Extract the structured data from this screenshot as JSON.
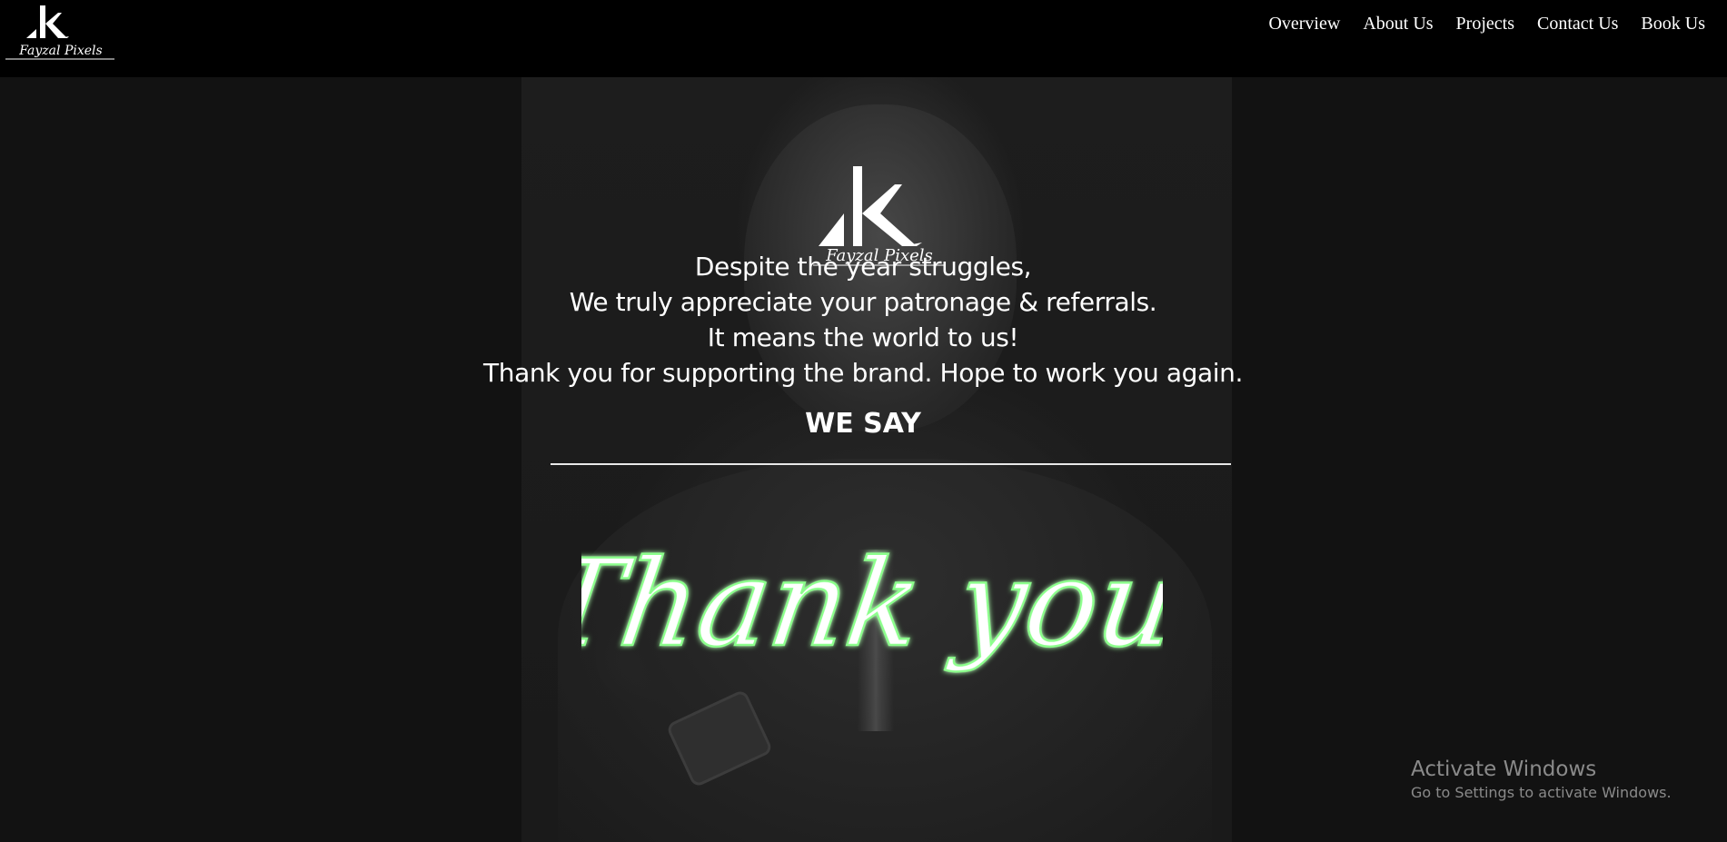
{
  "brand": {
    "logo_text": "Fayzal Pixels"
  },
  "nav": {
    "items": [
      "Overview",
      "About Us",
      "Projects",
      "Contact Us",
      "Book Us"
    ]
  },
  "hero": {
    "message_lines": [
      "Despite the year struggles,",
      "We truly appreciate your patronage & referrals.",
      "It means the world to us!",
      "Thank you for supporting the brand. Hope to work you again."
    ],
    "we_say": "WE SAY",
    "thank_you": "Thank you"
  },
  "colors": {
    "background": "#121212",
    "header": "#000000",
    "text": "#ffffff",
    "thank_you_glow": "#8cff8c"
  },
  "watermark": {
    "title": "Activate Windows",
    "subtitle": "Go to Settings to activate Windows."
  }
}
